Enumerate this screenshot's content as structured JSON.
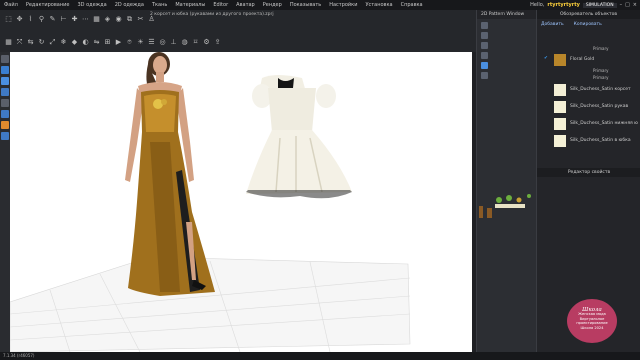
{
  "menu": {
    "items": [
      "Файл",
      "Редактирование",
      "3D одежда",
      "2D одежда",
      "Ткань",
      "Материалы",
      "Editor",
      "Аватар",
      "Рендер",
      "Показывать",
      "Настройки",
      "Установка",
      "Справка"
    ],
    "greeting": "Hello,",
    "username": "rtyrtyrtyrty",
    "mode": "SIMULATION"
  },
  "file_title": "2 корсет и юбка (рукавами из другого проекта).zprj",
  "pattern_window": {
    "title": "2D Pattern Window"
  },
  "object_browser": {
    "title": "Обозреватель объектов",
    "add_label": "Добавить",
    "copy_label": "Копировать",
    "top_sub": "Primary",
    "items": [
      {
        "name": "Floral Gold",
        "subs": [
          "Primary",
          "Primary"
        ]
      },
      {
        "name": "Silk_Duchess_Satin корсет"
      },
      {
        "name": "Silk_Duchess_Satin рукав"
      },
      {
        "name": "Silk_Duchess_Satin нижняя ю"
      },
      {
        "name": "Silk_Duchess_Satin в юбка"
      }
    ]
  },
  "property_editor": {
    "title": "Редактор свойств"
  },
  "status": {
    "text": "7.1.34 (r46057)"
  },
  "watermark": {
    "title": "Школа",
    "lines": [
      "Женская мода",
      "Виртуальное проектирование",
      "Школа 2024"
    ]
  },
  "colors": {
    "accent_user": "#ffd23c",
    "gold": "#b8862a",
    "satin": "#f4f0d6",
    "watermark": "#b83c62"
  }
}
